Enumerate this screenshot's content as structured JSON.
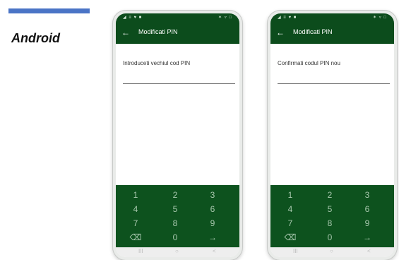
{
  "platform": "Android",
  "colors": {
    "accent": "#4a74c6",
    "app_green": "#0c4c1c",
    "keypad_green": "#0d521e",
    "key_text": "#a8c8ae"
  },
  "phones": [
    {
      "status_left": "◢ ≡ ♥ ■",
      "status_right": "✶ ▿ □",
      "title": "Modificati PIN",
      "prompt": "Introduceti vechiul cod PIN",
      "keys": [
        "1",
        "2",
        "3",
        "4",
        "5",
        "6",
        "7",
        "8",
        "9",
        "⌫",
        "0",
        "→"
      ],
      "nav": [
        "III",
        "○",
        "<"
      ]
    },
    {
      "status_left": "◢ ≡ ♥ ■",
      "status_right": "✶ ▿ □",
      "title": "Modificati PIN",
      "prompt": "Confirmati codul PIN nou",
      "keys": [
        "1",
        "2",
        "3",
        "4",
        "5",
        "6",
        "7",
        "8",
        "9",
        "⌫",
        "0",
        "→"
      ],
      "nav": [
        "III",
        "○",
        "<"
      ]
    }
  ]
}
